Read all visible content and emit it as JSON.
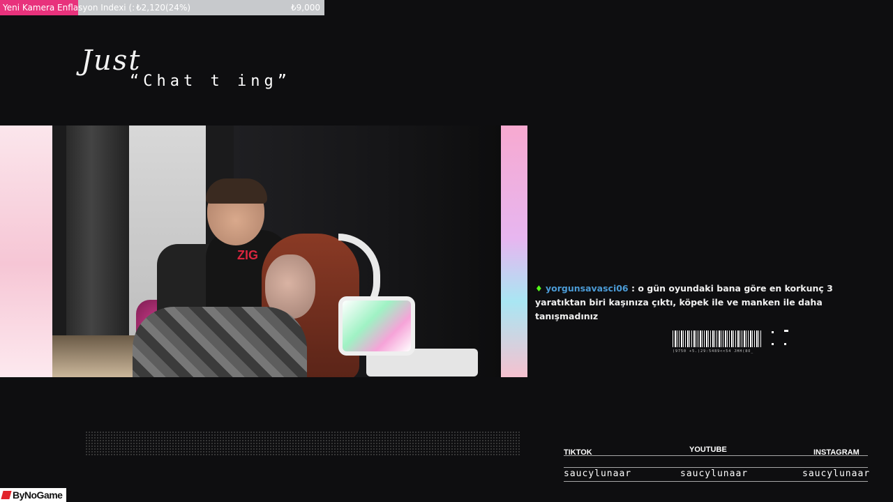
{
  "goal": {
    "title": "Yeni Kamera Enflasyon Indexi (:",
    "current": "₺2,120(24%)",
    "target": "₺9,000",
    "progress_fraction": 0.24,
    "fill_color": "#e8327c"
  },
  "scene": {
    "title_script": "Just",
    "title_sub": "“Chat t ing”"
  },
  "webcam": {
    "chair_logo": "ZIG"
  },
  "chat": {
    "badge_icon": "kick-icon",
    "username": "yorgunsavasci06",
    "separator": " : ",
    "message": "o gün oyundaki bana göre en korkunç 3 yaratıktan biri kaşınıza çıktı, köpek ile ve manken ile daha tanışmadınız"
  },
  "barcode": {
    "text": "(9750 +5.)29:5489<<54 JHH(8O_"
  },
  "socials": [
    {
      "label": "TIKTOK",
      "handle": "saucylunaar"
    },
    {
      "label": "YOUTUBE",
      "handle": "saucylunaar"
    },
    {
      "label": "INSTAGRAM",
      "handle": "saucylunaar"
    }
  ],
  "brand": {
    "logo_text": "ByNoGame",
    "logo_color": "#e2232a"
  }
}
